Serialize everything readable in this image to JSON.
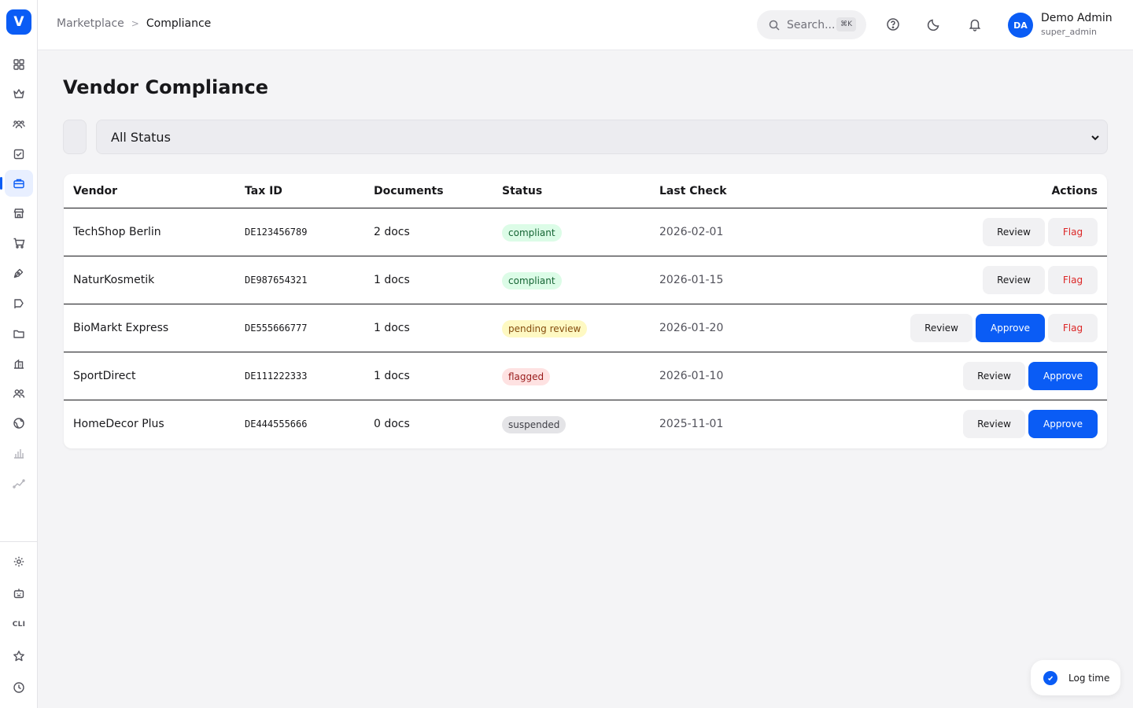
{
  "app": {
    "logo_letter": "V",
    "accent": "#0a5cf5"
  },
  "sidebar": {
    "items": [
      {
        "name": "dashboard-grid-icon",
        "active": false
      },
      {
        "name": "crown-icon",
        "active": false
      },
      {
        "name": "users-group-icon",
        "active": false
      },
      {
        "name": "checkbox-icon",
        "active": false
      },
      {
        "name": "briefcase-icon",
        "active": true
      },
      {
        "name": "store-icon",
        "active": false
      },
      {
        "name": "cart-icon",
        "active": false
      },
      {
        "name": "pen-nib-icon",
        "active": false
      },
      {
        "name": "flag-route-icon",
        "active": false
      },
      {
        "name": "folder-icon",
        "active": false
      },
      {
        "name": "building-chart-icon",
        "active": false
      },
      {
        "name": "people-icon",
        "active": false
      },
      {
        "name": "globe-icon",
        "active": false
      },
      {
        "name": "bar-chart-icon",
        "active": false
      },
      {
        "name": "trend-line-icon",
        "active": false
      }
    ],
    "bottom_items": [
      {
        "name": "settings-gear-icon"
      },
      {
        "name": "robot-icon"
      },
      {
        "name": "cli-text",
        "label": "CLI"
      },
      {
        "name": "star-icon"
      },
      {
        "name": "clock-icon"
      }
    ]
  },
  "header": {
    "breadcrumb": {
      "parent": "Marketplace",
      "separator": ">",
      "current": "Compliance"
    },
    "search": {
      "placeholder": "Search...",
      "shortcut": "⌘K"
    },
    "user": {
      "initials": "DA",
      "name": "Demo Admin",
      "role": "super_admin"
    }
  },
  "main": {
    "title": "Vendor Compliance",
    "filter": {
      "selected": "All Status"
    },
    "table": {
      "columns": [
        "Vendor",
        "Tax ID",
        "Documents",
        "Status",
        "Last Check",
        "Actions"
      ],
      "rows": [
        {
          "vendor": "TechShop Berlin",
          "tax_id": "DE123456789",
          "documents": "2 docs",
          "status": "compliant",
          "last_check": "2026-02-01",
          "actions": [
            "Review",
            "Flag"
          ]
        },
        {
          "vendor": "NaturKosmetik",
          "tax_id": "DE987654321",
          "documents": "1 docs",
          "status": "compliant",
          "last_check": "2026-01-15",
          "actions": [
            "Review",
            "Flag"
          ]
        },
        {
          "vendor": "BioMarkt Express",
          "tax_id": "DE555666777",
          "documents": "1 docs",
          "status": "pending review",
          "last_check": "2026-01-20",
          "actions": [
            "Review",
            "Approve",
            "Flag"
          ]
        },
        {
          "vendor": "SportDirect",
          "tax_id": "DE111222333",
          "documents": "1 docs",
          "status": "flagged",
          "last_check": "2026-01-10",
          "actions": [
            "Review",
            "Approve"
          ]
        },
        {
          "vendor": "HomeDecor Plus",
          "tax_id": "DE444555666",
          "documents": "0 docs",
          "status": "suspended",
          "last_check": "2025-11-01",
          "actions": [
            "Review",
            "Approve"
          ]
        }
      ]
    }
  },
  "floating": {
    "log_time_label": "Log time"
  }
}
